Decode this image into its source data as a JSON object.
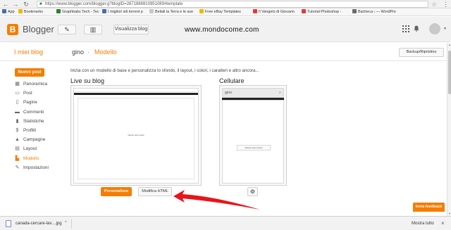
{
  "browser": {
    "back": "←",
    "forward": "→",
    "reload": "↻",
    "lock": "🔒",
    "url": "https://www.blogger.com/blogger.g?blogID=2671886910951089#template",
    "star": "☆",
    "menu": "⋮"
  },
  "bookmarks": {
    "apps": "App",
    "items": [
      {
        "label": "Bookmarks",
        "color": "#f2b600"
      },
      {
        "label": "Graphbabs Tech - Tec",
        "color": "#2e7d32"
      },
      {
        "label": "I migliori siti torrent p",
        "color": "#4a6fa5"
      },
      {
        "label": "Beliali la Terra e le sue",
        "color": "#8d8d8d"
      },
      {
        "label": "Free eBay Templates",
        "color": "#f2b600"
      },
      {
        "label": "Il Vangelo di Giovann",
        "color": "#e53935"
      },
      {
        "label": "Tutorial Photoshop -",
        "color": "#e53935"
      },
      {
        "label": "Bacheca ‹ — WordPre",
        "color": "#6b6b6b"
      }
    ]
  },
  "header": {
    "logo_letter": "B",
    "app_name": "Blogger",
    "edit_icon": "✎",
    "pages_icon": "▥",
    "view_blog": "Visualizza blog",
    "watermark": "www.mondocome.com",
    "apps_icon": "⋮⋮⋮",
    "bell_icon": "🔔",
    "avatar_caret": "▼"
  },
  "subheader": {
    "my_blogs": "I miei blog",
    "blog_name": "gino",
    "separator": "·",
    "section": "Modello",
    "backup": "Backup/Ripristino"
  },
  "sidebar": {
    "new_post": "Nuovo post",
    "items": [
      {
        "label": "Panoramica",
        "icon": "▦"
      },
      {
        "label": "Post",
        "icon": "▭"
      },
      {
        "label": "Pagine",
        "icon": "▯"
      },
      {
        "label": "Commenti",
        "icon": "▬"
      },
      {
        "label": "Statistiche",
        "icon": "▮"
      },
      {
        "label": "Profitti",
        "icon": "$"
      },
      {
        "label": "Campagne",
        "icon": "▲"
      },
      {
        "label": "Layout",
        "icon": "▤"
      },
      {
        "label": "Modello",
        "icon": "▙"
      },
      {
        "label": "Impostazioni",
        "icon": "✎"
      }
    ],
    "active_index": 8
  },
  "main": {
    "intro": "Inizia con un modello di base e personalizza lo sfondo, il layout, i colori, i caratteri e altro ancora...",
    "live_heading": "Live su blog",
    "mobile_heading": "Cellulare",
    "desktop_preview_msg": "Nessun post trovato",
    "mobile_blogname": "gino",
    "mobile_search_icon": "⌕",
    "mobile_preview_msg": "Nessun post trovato",
    "customize": "Personalizza",
    "edit_html": "Modifica HTML",
    "mobile_settings_icon": "⚙"
  },
  "scrollbar": {
    "up": "▲",
    "down": "▼"
  },
  "feedback": "Invia feedback",
  "download": {
    "filename": "canada-cercare-lav....jpg",
    "caret": "^",
    "show_all": "Mostra tutto",
    "close": "×"
  },
  "colors": {
    "accent": "#f57d00",
    "arrow": "#e8141a"
  }
}
